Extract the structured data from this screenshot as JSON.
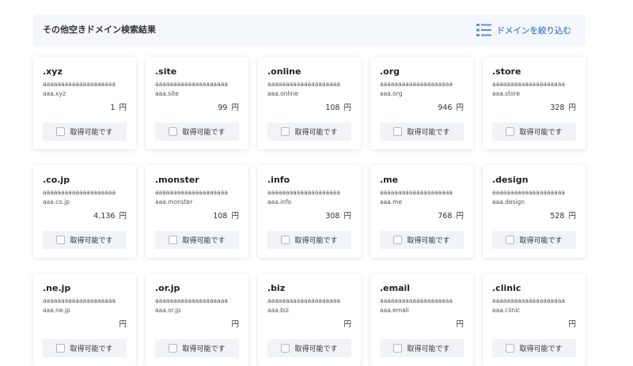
{
  "header": {
    "title": "その他空きドメイン検索結果",
    "filter_label": "ドメインを絞り込む",
    "filter_icon": "list-icon",
    "accent_color": "#5c8fd6"
  },
  "currency": "円",
  "available_label": "取得可能です",
  "cards": [
    {
      "tld": ".xyz",
      "prefix": "aaaaaaaaaaaaaaaaaaaa",
      "suffix": "aaa.xyz",
      "price": "1"
    },
    {
      "tld": ".site",
      "prefix": "aaaaaaaaaaaaaaaaaaaa",
      "suffix": "aaa.site",
      "price": "99"
    },
    {
      "tld": ".online",
      "prefix": "aaaaaaaaaaaaaaaaaaaa",
      "suffix": "aaa.online",
      "price": "108"
    },
    {
      "tld": ".org",
      "prefix": "aaaaaaaaaaaaaaaaaaaa",
      "suffix": "aaa.org",
      "price": "946"
    },
    {
      "tld": ".store",
      "prefix": "aaaaaaaaaaaaaaaaaaaa",
      "suffix": "aaa.store",
      "price": "328"
    },
    {
      "tld": ".co.jp",
      "prefix": "aaaaaaaaaaaaaaaaaaaa",
      "suffix": "aaa.co.jp",
      "price": "4,136"
    },
    {
      "tld": ".monster",
      "prefix": "aaaaaaaaaaaaaaaaaaaa",
      "suffix": "aaa.monster",
      "price": "108"
    },
    {
      "tld": ".info",
      "prefix": "aaaaaaaaaaaaaaaaaaaa",
      "suffix": "aaa.info",
      "price": "308"
    },
    {
      "tld": ".me",
      "prefix": "aaaaaaaaaaaaaaaaaaaa",
      "suffix": "aaa.me",
      "price": "768"
    },
    {
      "tld": ".design",
      "prefix": "aaaaaaaaaaaaaaaaaaaa",
      "suffix": "aaa.design",
      "price": "528"
    },
    {
      "tld": ".ne.jp",
      "prefix": "aaaaaaaaaaaaaaaaaaaa",
      "suffix": "aaa.ne.jp",
      "price": ""
    },
    {
      "tld": ".or.jp",
      "prefix": "aaaaaaaaaaaaaaaaaaaa",
      "suffix": "aaa.or.jp",
      "price": ""
    },
    {
      "tld": ".biz",
      "prefix": "aaaaaaaaaaaaaaaaaaaa",
      "suffix": "aaa.biz",
      "price": ""
    },
    {
      "tld": ".email",
      "prefix": "aaaaaaaaaaaaaaaaaaaa",
      "suffix": "aaa.email",
      "price": ""
    },
    {
      "tld": ".clinic",
      "prefix": "aaaaaaaaaaaaaaaaaaaa",
      "suffix": "aaa.clinic",
      "price": ""
    }
  ]
}
